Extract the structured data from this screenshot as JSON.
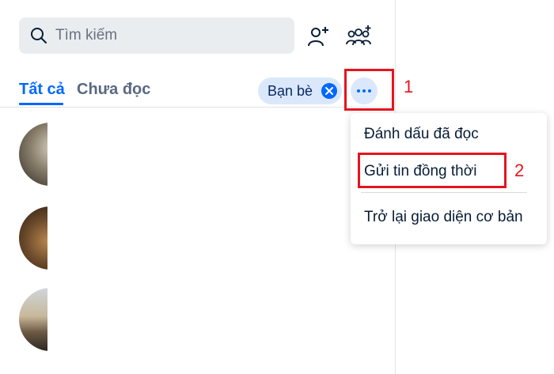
{
  "search": {
    "placeholder": "Tìm kiếm"
  },
  "header_icons": [
    "search-icon",
    "add-friend-icon",
    "add-group-icon"
  ],
  "tabs": [
    {
      "label": "Tất cả",
      "active": true
    },
    {
      "label": "Chưa đọc",
      "active": false
    }
  ],
  "filter_chip": {
    "label": "Bạn bè",
    "icon": "close-icon"
  },
  "more_button": {
    "icon": "more-horizontal-icon"
  },
  "menu": {
    "items": [
      {
        "label": "Đánh dấu đã đọc"
      },
      {
        "label": "Gửi tin đồng thời"
      },
      {
        "label": "Trở lại giao diện cơ bản"
      }
    ]
  },
  "annotations": [
    {
      "label": "1"
    },
    {
      "label": "2"
    }
  ],
  "colors": {
    "accent": "#0068ff",
    "chip_bg": "#dbe8fc",
    "search_bg": "#eaedf0",
    "annotation": "#e6141e",
    "text": "#081c36"
  }
}
